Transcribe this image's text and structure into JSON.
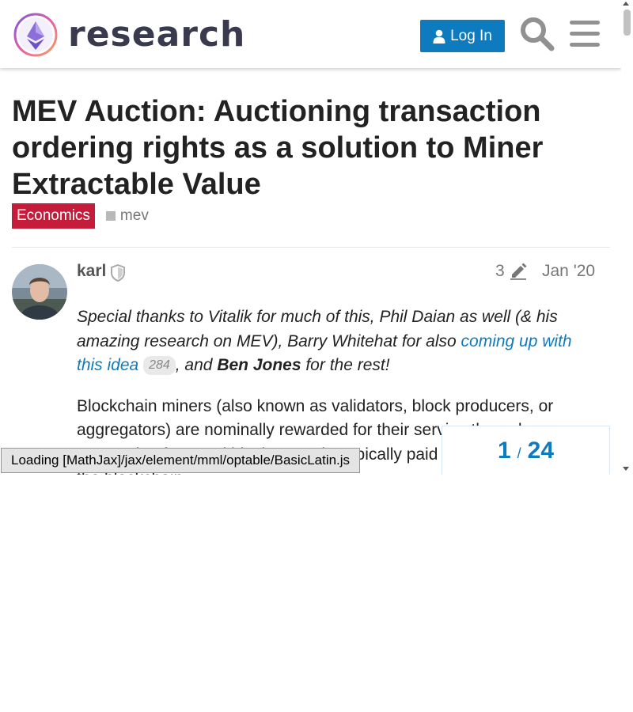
{
  "header": {
    "logo_text": "research",
    "login_label": "Log In",
    "search_icon": "search-icon",
    "menu_icon": "hamburger-menu-icon"
  },
  "topic": {
    "title": "MEV Auction: Auctioning transaction ordering rights as a solution to Miner Extractable Value",
    "category": "Economics",
    "category_color": "#c41c3a",
    "tag": "mev"
  },
  "post": {
    "author": "karl",
    "edit_count": "3",
    "date": "Jan '20",
    "p1": {
      "t1": "Special thanks to Vitalik for much of this, Phil Daian as well (& his amazing research on MEV), Barry Whitehat for also ",
      "link": "coming up with this idea",
      "clicks": "284",
      "t2": ", and ",
      "bold": "Ben Jones",
      "t3": " for the rest!"
    },
    "p2": "Blockchain miners (also known as validators, block producers, or aggregators) are nominally rewarded for their service through transaction fees and block rewards, typically paid in the native token of the blockchain."
  },
  "progress": {
    "current": "1",
    "total": "24"
  },
  "loading_message": "Loading [MathJax]/jax/element/mml/optable/BasicLatin.js",
  "colors": {
    "accent": "#0e7bbf",
    "text": "#222222",
    "muted": "#777777"
  }
}
